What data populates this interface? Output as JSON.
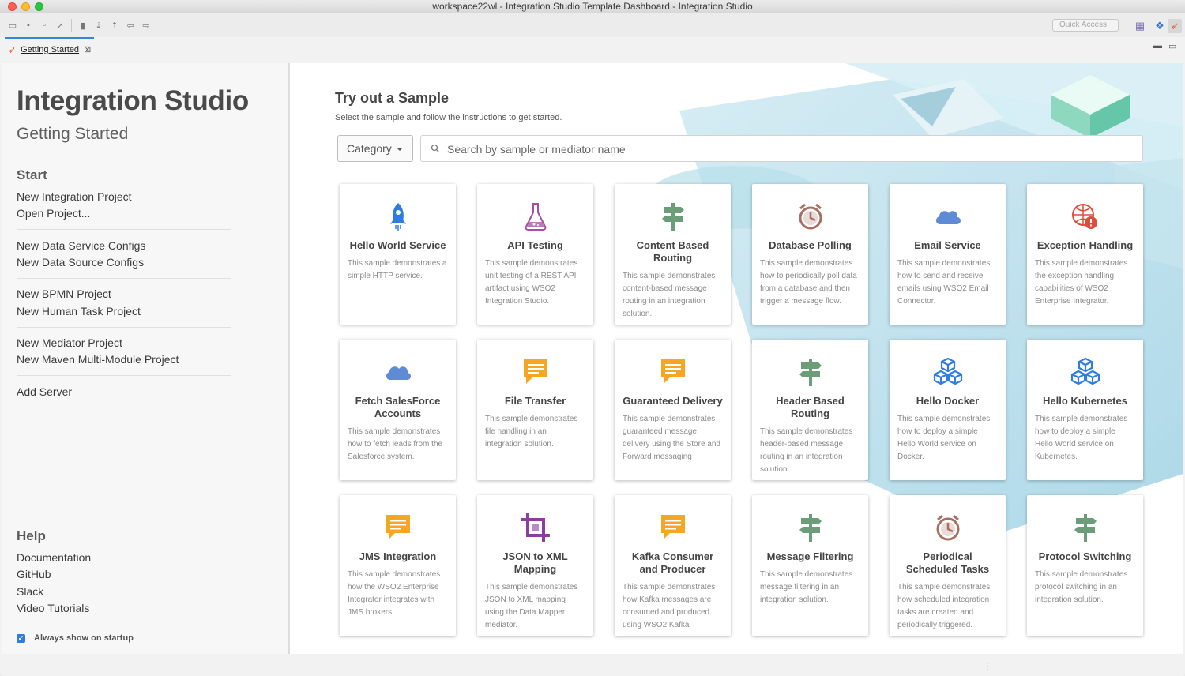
{
  "window": {
    "title": "workspace22wl - Integration Studio Template Dashboard - Integration Studio"
  },
  "toolbar": {
    "quick_access": "Quick Access"
  },
  "editor_tab": {
    "label": "Getting Started",
    "icon": "rocket-icon"
  },
  "sidebar": {
    "title": "Integration Studio",
    "subtitle": "Getting Started",
    "start_heading": "Start",
    "start_groups": [
      [
        "New Integration Project",
        "Open Project..."
      ],
      [
        "New Data Service Configs",
        "New Data Source Configs"
      ],
      [
        "New BPMN Project",
        "New Human Task Project"
      ],
      [
        "New Mediator Project",
        "New Maven Multi-Module Project"
      ],
      [
        "Add Server"
      ]
    ],
    "help_heading": "Help",
    "help_links": [
      "Documentation",
      "GitHub",
      "Slack",
      "Video Tutorials"
    ],
    "always_show": "Always show on startup",
    "always_show_checked": true
  },
  "main": {
    "title": "Try out a Sample",
    "description": "Select the sample and follow the instructions to get started.",
    "category": "Category",
    "search_placeholder": "Search by sample or mediator name"
  },
  "samples": [
    {
      "title": "Hello World Service",
      "desc": "This sample demonstrates a simple HTTP service.",
      "icon": "rocket-icon",
      "color": "#2f7de1"
    },
    {
      "title": "API Testing",
      "desc": "This sample demonstrates unit testing of a REST API artifact using WSO2 Integration Studio.",
      "icon": "flask-icon",
      "color": "#a64ea2"
    },
    {
      "title": "Content Based Routing",
      "desc": "This sample demonstrates content-based message routing in an integration solution.",
      "icon": "signpost-icon",
      "color": "#6b9e78"
    },
    {
      "title": "Database Polling",
      "desc": "This sample demonstrates how to periodically poll data from a database and then trigger a message flow.",
      "icon": "alarm-clock-icon",
      "color": "#a86f63"
    },
    {
      "title": "Email Service",
      "desc": "This sample demonstrates how to send and receive emails using WSO2 Email Connector.",
      "icon": "cloud-icon",
      "color": "#5e8ad6"
    },
    {
      "title": "Exception Handling",
      "desc": "This sample demonstrates the exception handling capabilities of WSO2 Enterprise Integrator.",
      "icon": "globe-alert-icon",
      "color": "#e04b3c"
    },
    {
      "title": "Fetch SalesForce Accounts",
      "desc": "This sample demonstrates how to fetch leads from the Salesforce system.",
      "icon": "cloud-icon",
      "color": "#5e8ad6"
    },
    {
      "title": "File Transfer",
      "desc": "This sample demonstrates file handling in an integration solution.",
      "icon": "message-icon",
      "color": "#f5a623"
    },
    {
      "title": "Guaranteed Delivery",
      "desc": "This sample demonstrates guaranteed message delivery using the Store and Forward messaging",
      "icon": "message-icon",
      "color": "#f5a623"
    },
    {
      "title": "Header Based Routing",
      "desc": "This sample demonstrates header-based message routing in an integration solution.",
      "icon": "signpost-icon",
      "color": "#6b9e78"
    },
    {
      "title": "Hello Docker",
      "desc": "This sample demonstrates how to deploy a simple Hello World service on Docker.",
      "icon": "cubes-icon",
      "color": "#2f7de1"
    },
    {
      "title": "Hello Kubernetes",
      "desc": "This sample demonstrates how to deploy a simple Hello World service on Kubernetes.",
      "icon": "cubes-icon",
      "color": "#2f7de1"
    },
    {
      "title": "JMS Integration",
      "desc": "This sample demonstrates how the WSO2 Enterprise Integrator integrates with JMS brokers.",
      "icon": "message-icon",
      "color": "#f5a623"
    },
    {
      "title": "JSON to XML Mapping",
      "desc": "This sample demonstrates JSON to XML mapping using the Data Mapper mediator.",
      "icon": "crop-icon",
      "color": "#8a3fa0"
    },
    {
      "title": "Kafka Consumer and Producer",
      "desc": "This sample demonstrates how Kafka messages are consumed and produced using WSO2 Kafka",
      "icon": "message-icon",
      "color": "#f5a623"
    },
    {
      "title": "Message Filtering",
      "desc": "This sample demonstrates message filtering in an integration solution.",
      "icon": "signpost-icon",
      "color": "#6b9e78"
    },
    {
      "title": "Periodical Scheduled Tasks",
      "desc": "This sample demonstrates how scheduled integration tasks are created and periodically triggered.",
      "icon": "alarm-clock-icon",
      "color": "#a86f63"
    },
    {
      "title": "Protocol Switching",
      "desc": "This sample demonstrates protocol switching in an integration solution.",
      "icon": "signpost-icon",
      "color": "#6b9e78"
    }
  ]
}
